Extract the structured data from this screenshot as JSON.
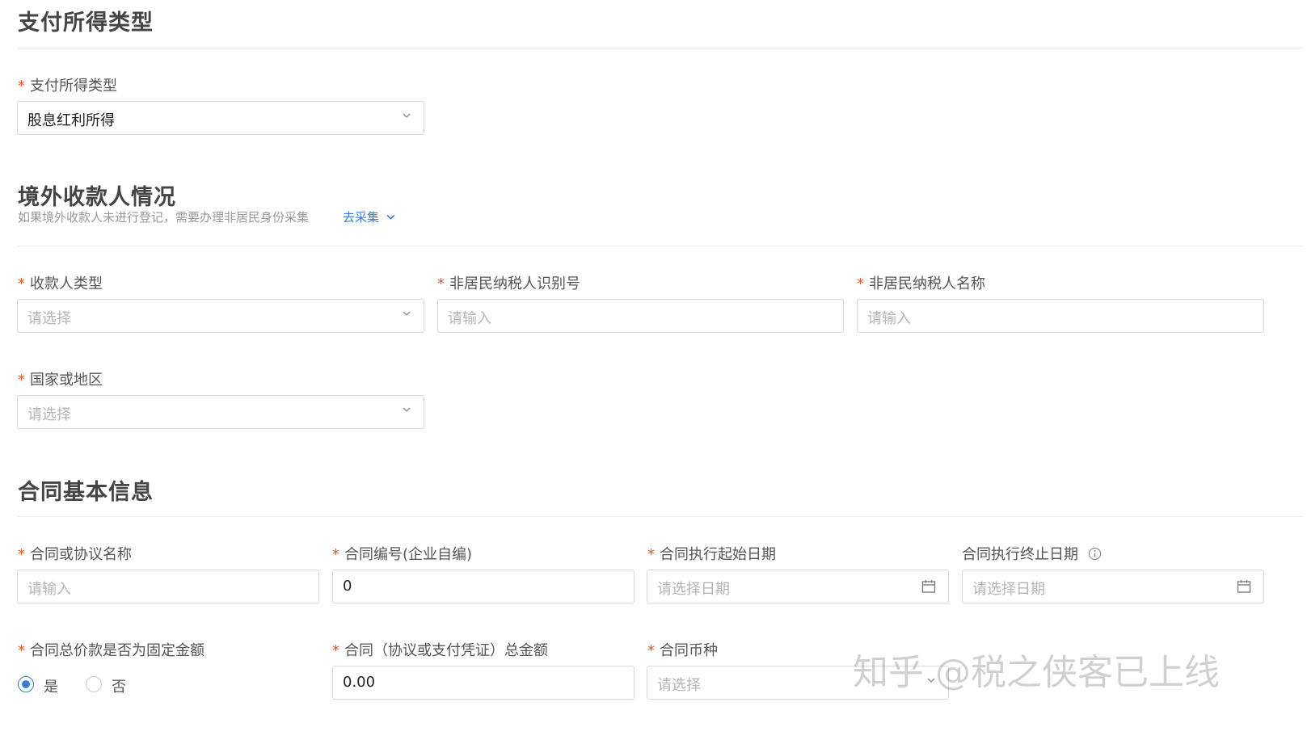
{
  "sections": {
    "payment": {
      "title": "支付所得类型"
    },
    "payee": {
      "title": "境外收款人情况",
      "hint": "如果境外收款人未进行登记，需要办理非居民身份采集",
      "link": "去采集"
    },
    "contract": {
      "title": "合同基本信息"
    }
  },
  "required_mark": "*",
  "fields": {
    "payment_type": {
      "label": "支付所得类型",
      "value": "股息红利所得"
    },
    "payee_type": {
      "label": "收款人类型",
      "placeholder": "请选择"
    },
    "tax_id": {
      "label": "非居民纳税人识别号",
      "placeholder": "请输入"
    },
    "taxpayer_name": {
      "label": "非居民纳税人名称",
      "placeholder": "请输入"
    },
    "country": {
      "label": "国家或地区",
      "placeholder": "请选择"
    },
    "contract_name": {
      "label": "合同或协议名称",
      "placeholder": "请输入"
    },
    "contract_no": {
      "label": "合同编号(企业自编)",
      "value": "0"
    },
    "start_date": {
      "label": "合同执行起始日期",
      "placeholder": "请选择日期"
    },
    "end_date": {
      "label": "合同执行终止日期",
      "placeholder": "请选择日期"
    },
    "fixed_amount": {
      "label": "合同总价款是否为固定金额",
      "options": [
        "是",
        "否"
      ],
      "selected": "是"
    },
    "total_amount": {
      "label": "合同（协议或支付凭证）总金额",
      "value": "0.00"
    },
    "currency": {
      "label": "合同币种",
      "placeholder": "请选择"
    }
  },
  "watermark": "知乎 @税之侠客已上线",
  "colors": {
    "accent": "#3a7bd5",
    "required": "#e8541c"
  }
}
